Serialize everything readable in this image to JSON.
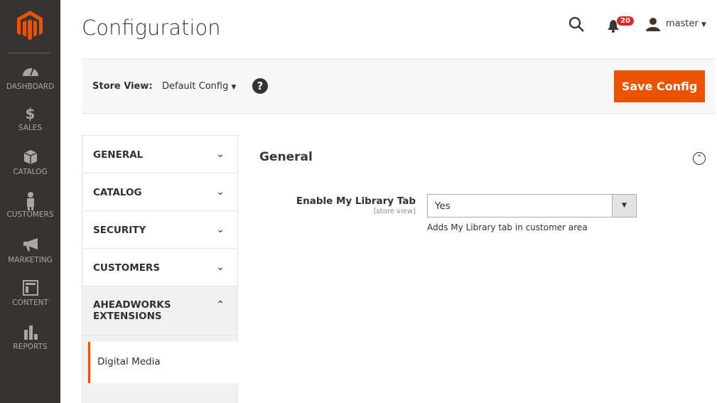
{
  "nav": [
    {
      "label": "DASHBOARD",
      "icon": "gauge-icon"
    },
    {
      "label": "SALES",
      "icon": "dollar-icon"
    },
    {
      "label": "CATALOG",
      "icon": "box-icon"
    },
    {
      "label": "CUSTOMERS",
      "icon": "person-icon"
    },
    {
      "label": "MARKETING",
      "icon": "megaphone-icon"
    },
    {
      "label": "CONTENT",
      "icon": "layout-icon"
    },
    {
      "label": "REPORTS",
      "icon": "bar-chart-icon"
    }
  ],
  "header": {
    "title": "Configuration",
    "notifications": "20",
    "user": "master"
  },
  "toolbar": {
    "store_view_label": "Store View:",
    "store_view_value": "Default Config",
    "save_label": "Save Config"
  },
  "tabs": [
    {
      "label": "GENERAL"
    },
    {
      "label": "CATALOG"
    },
    {
      "label": "SECURITY"
    },
    {
      "label": "CUSTOMERS"
    },
    {
      "label": "AHEADWORKS EXTENSIONS"
    }
  ],
  "subtab": "Digital Media",
  "section": {
    "title": "General",
    "field_label": "Enable My Library Tab",
    "scope": "[store view]",
    "value": "Yes",
    "note": "Adds My Library tab in customer area"
  },
  "colors": {
    "accent": "#eb5202",
    "nav_bg": "#373330"
  }
}
